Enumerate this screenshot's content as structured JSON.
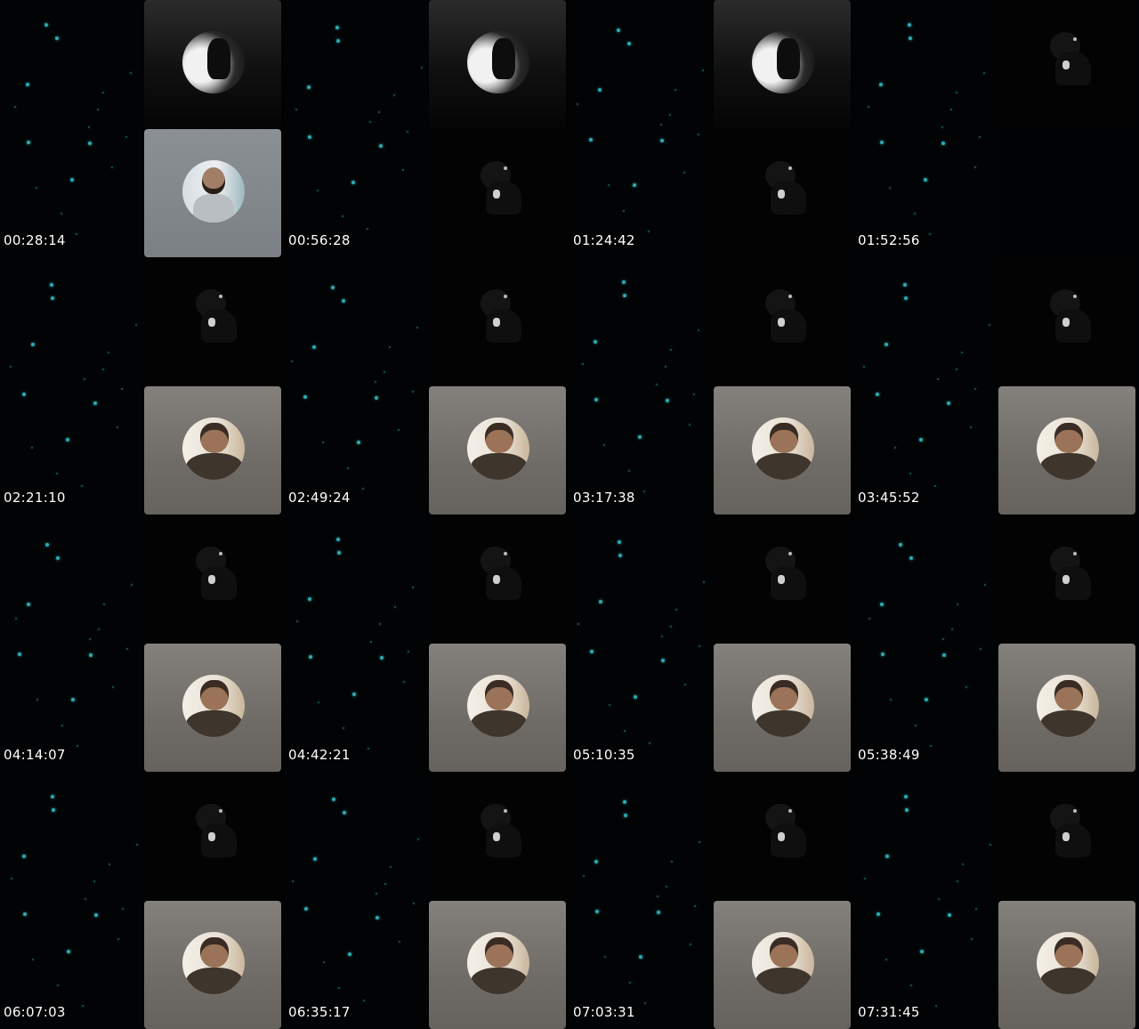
{
  "frames": [
    {
      "timestamp": "00:28:14",
      "top_tile": "dark",
      "top_avatar": "moon",
      "bottom_tile": "blue",
      "bottom_avatar": "man-suit"
    },
    {
      "timestamp": "00:56:28",
      "top_tile": "dark",
      "top_avatar": "moon",
      "bottom_tile": "black",
      "bottom_avatar": "silhouette"
    },
    {
      "timestamp": "01:24:42",
      "top_tile": "dark",
      "top_avatar": "moon",
      "bottom_tile": "black",
      "bottom_avatar": "silhouette"
    },
    {
      "timestamp": "01:52:56",
      "top_tile": "black",
      "top_avatar": "silhouette",
      "bottom_tile": "none",
      "bottom_avatar": "none"
    },
    {
      "timestamp": "02:21:10",
      "top_tile": "black",
      "top_avatar": "silhouette",
      "bottom_tile": "gray",
      "bottom_avatar": "man-room"
    },
    {
      "timestamp": "02:49:24",
      "top_tile": "black",
      "top_avatar": "silhouette",
      "bottom_tile": "gray",
      "bottom_avatar": "man-room"
    },
    {
      "timestamp": "03:17:38",
      "top_tile": "black",
      "top_avatar": "silhouette",
      "bottom_tile": "gray",
      "bottom_avatar": "man-room"
    },
    {
      "timestamp": "03:45:52",
      "top_tile": "black",
      "top_avatar": "silhouette",
      "bottom_tile": "gray",
      "bottom_avatar": "man-room"
    },
    {
      "timestamp": "04:14:07",
      "top_tile": "black",
      "top_avatar": "silhouette",
      "bottom_tile": "gray",
      "bottom_avatar": "man-room"
    },
    {
      "timestamp": "04:42:21",
      "top_tile": "black",
      "top_avatar": "silhouette",
      "bottom_tile": "gray",
      "bottom_avatar": "man-room"
    },
    {
      "timestamp": "05:10:35",
      "top_tile": "black",
      "top_avatar": "silhouette",
      "bottom_tile": "gray",
      "bottom_avatar": "man-room"
    },
    {
      "timestamp": "05:38:49",
      "top_tile": "black",
      "top_avatar": "silhouette",
      "bottom_tile": "gray",
      "bottom_avatar": "man-room"
    },
    {
      "timestamp": "06:07:03",
      "top_tile": "black",
      "top_avatar": "silhouette",
      "bottom_tile": "gray",
      "bottom_avatar": "man-room"
    },
    {
      "timestamp": "06:35:17",
      "top_tile": "black",
      "top_avatar": "silhouette",
      "bottom_tile": "gray",
      "bottom_avatar": "man-room"
    },
    {
      "timestamp": "07:03:31",
      "top_tile": "black",
      "top_avatar": "silhouette",
      "bottom_tile": "gray",
      "bottom_avatar": "man-room"
    },
    {
      "timestamp": "07:31:45",
      "top_tile": "black",
      "top_avatar": "silhouette",
      "bottom_tile": "gray",
      "bottom_avatar": "man-room"
    }
  ],
  "colors": {
    "background": "#000000",
    "star": "#35c7cf",
    "timestamp_text": "#ffffff"
  }
}
